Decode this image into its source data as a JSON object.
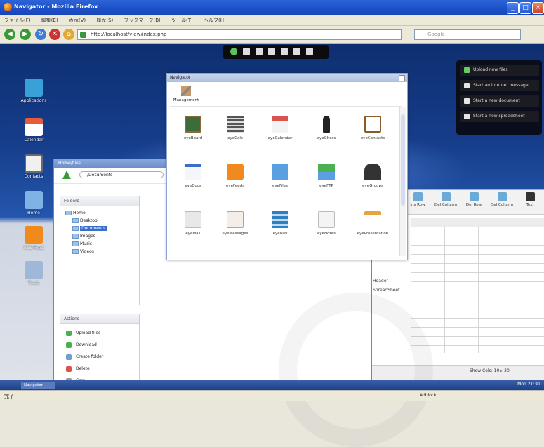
{
  "browser": {
    "title": "Navigator - Mozilla Firefox",
    "menu": [
      "ファイル(F)",
      "編集(E)",
      "表示(V)",
      "履歴(S)",
      "ブックマーク(B)",
      "ツール(T)",
      "ヘルプ(H)"
    ],
    "url": "http://localhost/view/index.php",
    "search_placeholder": "Google",
    "status_left": "完了",
    "status_right": "Adblock"
  },
  "desktop": {
    "icons": [
      {
        "label": "Applications",
        "color": "#3aa0d8"
      },
      {
        "label": "Calendar",
        "color": "#e85a3a"
      },
      {
        "label": "Contacts",
        "color": "#f0f0f0"
      },
      {
        "label": "Home",
        "color": "#7fb3e6"
      },
      {
        "label": "RSS Feed",
        "color": "#f08a1c"
      },
      {
        "label": "Trash",
        "color": "#9fb8d8"
      }
    ],
    "actions": [
      "Upload new files",
      "Start an internet message",
      "Start a new document",
      "Start a new spreadsheet"
    ]
  },
  "filemanager": {
    "title": "Home/files",
    "path": "/Documents",
    "folders_title": "Folders",
    "tree": [
      "Home",
      "Desktop",
      "Documents",
      "Images",
      "Music",
      "Videos"
    ],
    "actions_title": "Actions",
    "actions": [
      "Upload files",
      "Download",
      "Create folder",
      "Delete",
      "Copy"
    ]
  },
  "navigator": {
    "title": "Navigator",
    "manager_label": "Management",
    "apps": [
      {
        "label": "eyeBoard",
        "color": "#3c6b3c"
      },
      {
        "label": "eyeCalc",
        "color": "#555555"
      },
      {
        "label": "eyeCalendar",
        "color": "#d9534f"
      },
      {
        "label": "eyeChess",
        "color": "#222222"
      },
      {
        "label": "eyeContacts",
        "color": "#8b5a2b"
      },
      {
        "label": "eyeDocs",
        "color": "#3b6ec9"
      },
      {
        "label": "eyeFeeds",
        "color": "#f08a1c"
      },
      {
        "label": "eyeFiles",
        "color": "#5aa0e0"
      },
      {
        "label": "eyeFTP",
        "color": "#4caf50"
      },
      {
        "label": "eyeGroups",
        "color": "#333333"
      },
      {
        "label": "eyeMail",
        "color": "#c8c8c8"
      },
      {
        "label": "eyeMessages",
        "color": "#d79a6b"
      },
      {
        "label": "eyeNav",
        "color": "#2f7fbf"
      },
      {
        "label": "eyeNotes",
        "color": "#7a7a7a"
      },
      {
        "label": "eyePresentation",
        "color": "#e8a43c"
      }
    ]
  },
  "spreadsheet": {
    "toolbar": [
      "Ins Row",
      "Del Column",
      "Del Row",
      "Del Column",
      "Text"
    ],
    "cells": [
      "Header",
      "SpreadSheet"
    ],
    "pager": "Show Cols: 10  ▸  30"
  },
  "taskbar": {
    "item": "Navigator",
    "clock": "Mon 21:30"
  }
}
